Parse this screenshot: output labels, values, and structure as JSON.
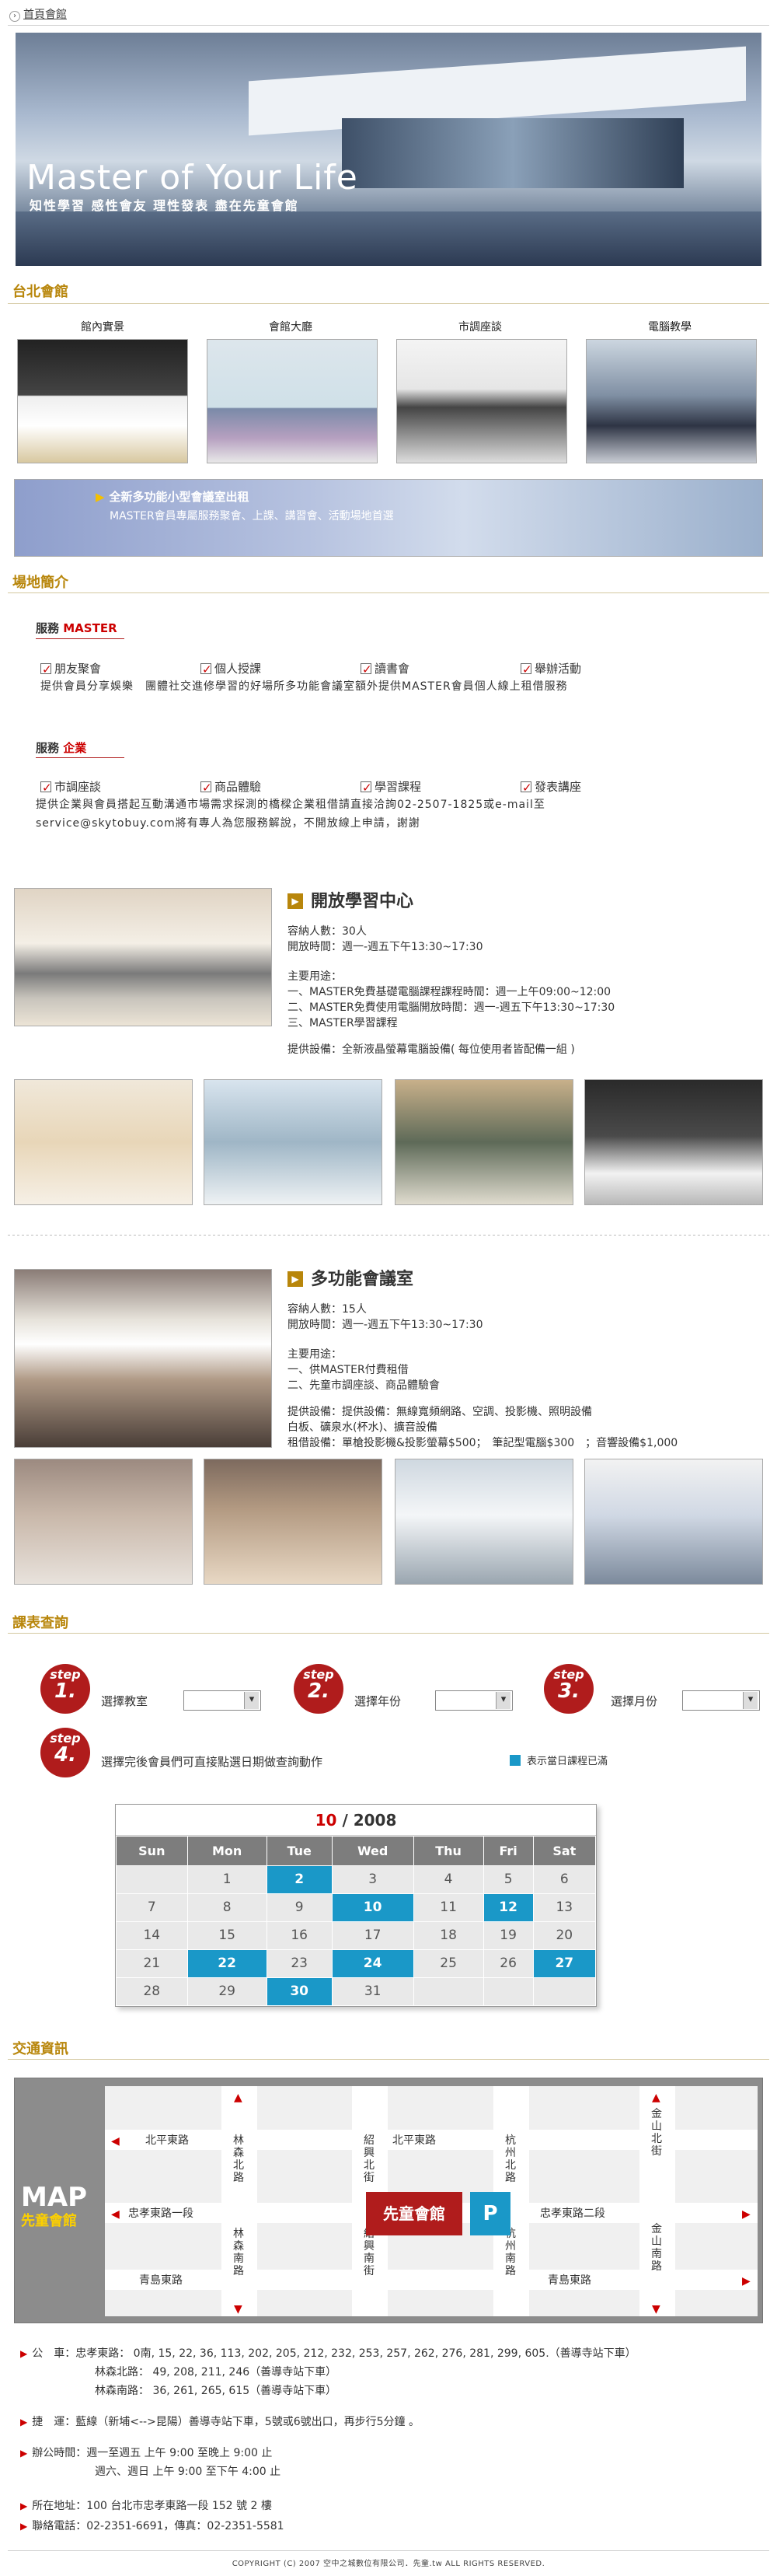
{
  "breadcrumb": "首頁會館",
  "hero": {
    "title": "Master of Your Life",
    "subtitle": "知性學習 感性會友 理性發表 盡在先童會館"
  },
  "sections": {
    "taipei": "台北會館",
    "venue": "場地簡介",
    "schedule": "課表查詢",
    "traffic": "交通資訊"
  },
  "photos": [
    "館內實景",
    "會館大廳",
    "市調座談",
    "電腦教學"
  ],
  "banner": {
    "line1": "全新多功能小型會議室出租",
    "line2": "MASTER會員專屬服務聚會、上課、講習會、活動場地首選"
  },
  "service_master": {
    "title_prefix": "服務",
    "title_highlight": "MASTER",
    "items": [
      "朋友聚會",
      "個人授課",
      "讀書會",
      "舉辦活動"
    ],
    "desc": "提供會員分享娛樂　團體社交進修學習的好場所多功能會議室額外提供MASTER會員個人線上租借服務"
  },
  "service_enterprise": {
    "title_prefix": "服務",
    "title_highlight": "企業",
    "items": [
      "市調座談",
      "商品體驗",
      "學習課程",
      "發表講座"
    ],
    "desc1": "提供企業與會員搭起互動溝通市場需求探測的橋樑企業租借請直接洽詢02-2507-1825或e-mail至",
    "desc2": "service@skytobuy.com將有專人為您服務解說，不開放線上申請，謝謝"
  },
  "room1": {
    "title": "開放學習中心",
    "capacity": "容納人數：30人",
    "hours": "開放時間：週一-週五下午13:30~17:30",
    "usage_title": "主要用途：",
    "usage": [
      "一、MASTER免費基礎電腦課程課程時間：週一上午09:00~12:00",
      "二、MASTER免費使用電腦開放時間：週一-週五下午13:30~17:30",
      "三、MASTER學習課程"
    ],
    "equipment": "提供設備：全新液晶螢幕電腦設備( 每位使用者皆配備一組 )"
  },
  "room2": {
    "title": "多功能會議室",
    "capacity": "容納人數：15人",
    "hours": "開放時間：週一-週五下午13:30~17:30",
    "usage_title": "主要用途：",
    "usage": [
      "一、供MASTER付費租借",
      "二、先童市調座談、商品體驗會"
    ],
    "equip1": "提供設備：提供設備：無線寬頻網路、空調、投影機、照明設備",
    "equip2": "白板、礦泉水(杯水)、擴音設備",
    "equip3": "租借設備：單槍投影機&投影螢幕$500；　筆記型電腦$300　；音響設備$1,000"
  },
  "schedule": {
    "steps": [
      {
        "label": "step",
        "num": "1.",
        "text": "選擇教室"
      },
      {
        "label": "step",
        "num": "2.",
        "text": "選擇年份"
      },
      {
        "label": "step",
        "num": "3.",
        "text": "選擇月份"
      },
      {
        "label": "step",
        "num": "4.",
        "text": "選擇完後會員們可直接點選日期做查詢動作"
      }
    ],
    "legend": "表示當日課程已滿",
    "accent": "#1a98c8"
  },
  "calendar": {
    "month": "10",
    "year": "/ 2008",
    "weekdays": [
      "Sun",
      "Mon",
      "Tue",
      "Wed",
      "Thu",
      "Fri",
      "Sat"
    ],
    "weeks": [
      [
        "",
        "1",
        "2",
        "3",
        "4",
        "5",
        "6"
      ],
      [
        "7",
        "8",
        "9",
        "10",
        "11",
        "12",
        "13"
      ],
      [
        "14",
        "15",
        "16",
        "17",
        "18",
        "19",
        "20"
      ],
      [
        "21",
        "22",
        "23",
        "24",
        "25",
        "26",
        "27"
      ],
      [
        "28",
        "29",
        "30",
        "31",
        "",
        "",
        ""
      ]
    ],
    "full_days": [
      "2",
      "10",
      "12",
      "22",
      "24",
      "27",
      "30"
    ]
  },
  "map": {
    "title": "MAP",
    "subtitle": "先童會館",
    "building": "先童會館",
    "parking": "P",
    "roads_h": [
      "北平東路",
      "北平東路",
      "忠孝東路一段",
      "忠孝東路二段",
      "青島東路",
      "青島東路"
    ],
    "roads_v": [
      "林森北路",
      "紹興北街",
      "杭州北路",
      "金山北街",
      "林森南路",
      "紹興南街",
      "杭州南路",
      "金山南路"
    ]
  },
  "traffic": {
    "bus_label": "公　車：",
    "bus1": "忠孝東路：  0南, 15, 22, 36, 113, 202, 205, 212, 232, 253, 257, 262, 276, 281, 299, 605.（善導寺站下車）",
    "bus2": "林森北路：  49, 208, 211, 246（善導寺站下車）",
    "bus3": "林森南路：  36, 261, 265, 615（善導寺站下車）",
    "mrt_label": "捷　運：",
    "mrt": "藍線（新埔<-->昆陽）善導寺站下車，5號或6號出口，再步行5分鐘 。",
    "hours_label": "辦公時間：",
    "hours1": "週一至週五 上午 9:00 至晚上 9:00 止",
    "hours2": "週六、週日 上午 9:00 至下午 4:00 止",
    "address": "所在地址：100 台北市忠孝東路一段 152 號 2 樓",
    "phone": "聯絡電話：02-2351-6691，傳真：02-2351-5581"
  },
  "footer": "COPYRIGHT (C) 2007 空中之城數位有限公司．先童.tw ALL RIGHTS RESERVED."
}
